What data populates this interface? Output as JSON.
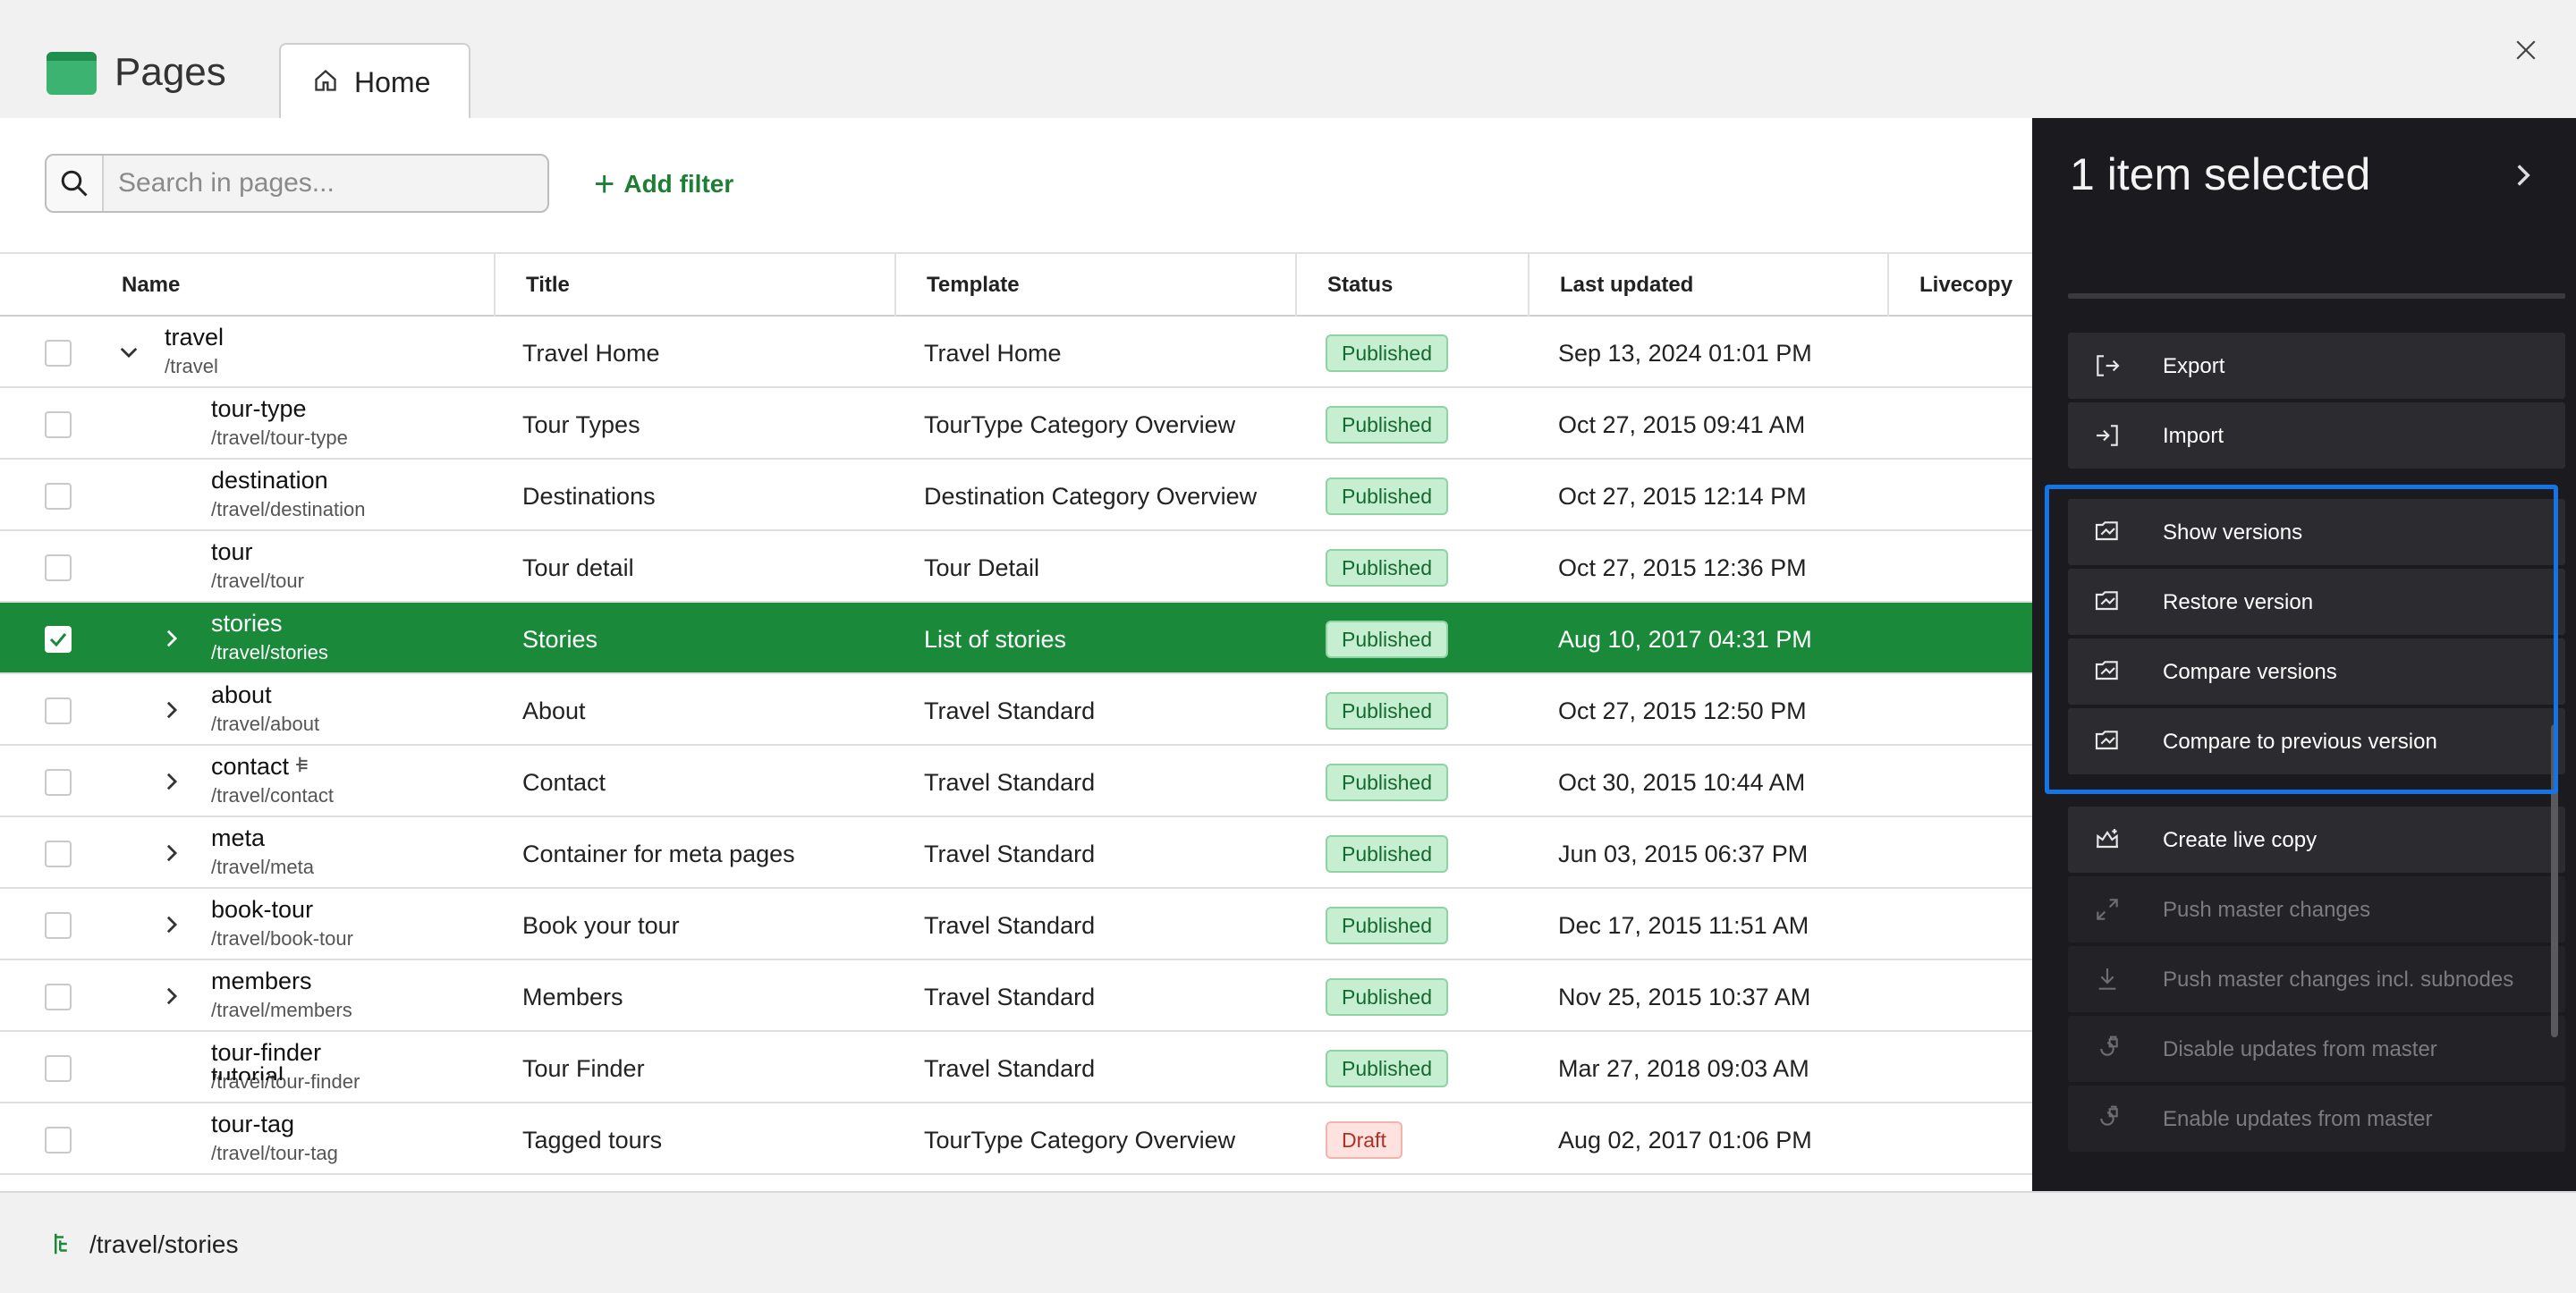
{
  "header": {
    "app_title": "Pages",
    "tab_home_label": "Home"
  },
  "toolbar": {
    "search_placeholder": "Search in pages...",
    "add_filter_label": "Add filter"
  },
  "table": {
    "columns": [
      "Name",
      "Title",
      "Template",
      "Status",
      "Last updated",
      "Livecopy"
    ],
    "rows": [
      {
        "name": "travel",
        "path": "/travel",
        "title": "Travel Home",
        "template": "Travel Home",
        "status": "Published",
        "updated": "Sep 13, 2024 01:01 PM",
        "expand": "open",
        "selected": false
      },
      {
        "name": "tour-type",
        "path": "/travel/tour-type",
        "title": "Tour Types",
        "template": "TourType Category Overview",
        "status": "Published",
        "updated": "Oct 27, 2015 09:41 AM",
        "expand": "none",
        "selected": false
      },
      {
        "name": "destination",
        "path": "/travel/destination",
        "title": "Destinations",
        "template": "Destination Category Overview",
        "status": "Published",
        "updated": "Oct 27, 2015 12:14 PM",
        "expand": "none",
        "selected": false
      },
      {
        "name": "tour",
        "path": "/travel/tour",
        "title": "Tour detail",
        "template": "Tour Detail",
        "status": "Published",
        "updated": "Oct 27, 2015 12:36 PM",
        "expand": "none",
        "selected": false
      },
      {
        "name": "stories",
        "path": "/travel/stories",
        "title": "Stories",
        "template": "List of stories",
        "status": "Published",
        "updated": "Aug 10, 2017 04:31 PM",
        "expand": "closed",
        "selected": true
      },
      {
        "name": "about",
        "path": "/travel/about",
        "title": "About",
        "template": "Travel Standard",
        "status": "Published",
        "updated": "Oct 27, 2015 12:50 PM",
        "expand": "closed",
        "selected": false
      },
      {
        "name": "contact",
        "path": "/travel/contact",
        "title": "Contact",
        "template": "Travel Standard",
        "status": "Published",
        "updated": "Oct 30, 2015 10:44 AM",
        "expand": "closed",
        "selected": false
      },
      {
        "name": "meta",
        "path": "/travel/meta",
        "title": "Container for meta pages",
        "template": "Travel Standard",
        "status": "Published",
        "updated": "Jun 03, 2015 06:37 PM",
        "expand": "closed",
        "selected": false
      },
      {
        "name": "book-tour",
        "path": "/travel/book-tour",
        "title": "Book your tour",
        "template": "Travel Standard",
        "status": "Published",
        "updated": "Dec 17, 2015 11:51 AM",
        "expand": "closed",
        "selected": false
      },
      {
        "name": "members",
        "path": "/travel/members",
        "title": "Members",
        "template": "Travel Standard",
        "status": "Published",
        "updated": "Nov 25, 2015 10:37 AM",
        "expand": "closed",
        "selected": false
      },
      {
        "name": "tour-finder",
        "path": "/travel/tour-finder",
        "title": "Tour Finder",
        "template": "Travel Standard",
        "status": "Published",
        "updated": "Mar 27, 2018 09:03 AM",
        "expand": "none",
        "selected": false
      },
      {
        "name": "tour-tag",
        "path": "/travel/tour-tag",
        "title": "Tagged tours",
        "template": "TourType Category Overview",
        "status": "Draft",
        "updated": "Aug 02, 2017 01:06 PM",
        "expand": "none",
        "selected": false
      }
    ],
    "partial_row_name": "tutorial"
  },
  "footer": {
    "path": "/travel/stories"
  },
  "side_panel": {
    "title": "1 item selected",
    "actions": [
      {
        "label": "Export",
        "icon": "export-icon",
        "enabled": true
      },
      {
        "label": "Import",
        "icon": "import-icon",
        "enabled": true
      },
      {
        "label": "Show versions",
        "icon": "versions-icon",
        "enabled": true
      },
      {
        "label": "Restore version",
        "icon": "versions-icon",
        "enabled": true
      },
      {
        "label": "Compare versions",
        "icon": "versions-icon",
        "enabled": true
      },
      {
        "label": "Compare to previous version",
        "icon": "versions-icon",
        "enabled": true
      },
      {
        "label": "Create live copy",
        "icon": "live-copy-icon",
        "enabled": true
      },
      {
        "label": "Push master changes",
        "icon": "push-icon",
        "enabled": false
      },
      {
        "label": "Push master changes incl. subnodes",
        "icon": "push-subnodes-icon",
        "enabled": false
      },
      {
        "label": "Disable updates from master",
        "icon": "lock-icon",
        "enabled": false
      },
      {
        "label": "Enable updates from master",
        "icon": "unlock-icon",
        "enabled": false
      }
    ]
  },
  "colors": {
    "accent_green": "#1a8a3a",
    "highlight_blue": "#1673e6",
    "panel_dark": "#1b1b1f"
  }
}
